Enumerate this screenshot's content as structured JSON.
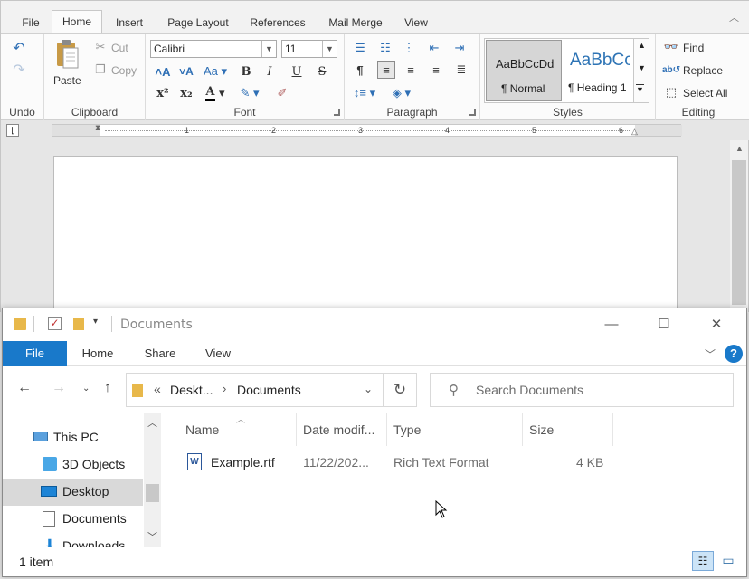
{
  "editor": {
    "tabs": [
      "File",
      "Home",
      "Insert",
      "Page Layout",
      "References",
      "Mail Merge",
      "View"
    ],
    "active_tab": "Home",
    "undo": {
      "label": "Undo"
    },
    "clipboard": {
      "paste": "Paste",
      "cut": "Cut",
      "copy": "Copy",
      "group": "Clipboard"
    },
    "font": {
      "name": "Calibri",
      "size": "11",
      "group": "Font"
    },
    "paragraph": {
      "group": "Paragraph"
    },
    "styles": {
      "group": "Styles",
      "normal_preview": "AaBbCcDd",
      "normal_label": "¶ Normal",
      "heading_preview": "AaBbCc",
      "heading_label": "¶ Heading 1"
    },
    "editing": {
      "group": "Editing",
      "find": "Find",
      "replace": "Replace",
      "select_all": "Select All"
    },
    "ruler_numbers": [
      "1",
      "2",
      "3",
      "4",
      "5",
      "6"
    ]
  },
  "explorer": {
    "title": "Documents",
    "tabs": [
      "File",
      "Home",
      "Share",
      "View"
    ],
    "address": {
      "prefix": "«",
      "crumb1": "Deskt...",
      "crumb2": "Documents"
    },
    "search_placeholder": "Search Documents",
    "nav": [
      "This PC",
      "3D Objects",
      "Desktop",
      "Documents",
      "Downloads"
    ],
    "selected_nav": "Desktop",
    "columns": [
      "Name",
      "Date modif...",
      "Type",
      "Size"
    ],
    "files": [
      {
        "name": "Example.rtf",
        "date": "11/22/202...",
        "type": "Rich Text Format",
        "size": "4 KB"
      }
    ],
    "status": "1 item"
  },
  "colors": {
    "accent": "#1979ca",
    "selection": "#d9d9d9"
  }
}
